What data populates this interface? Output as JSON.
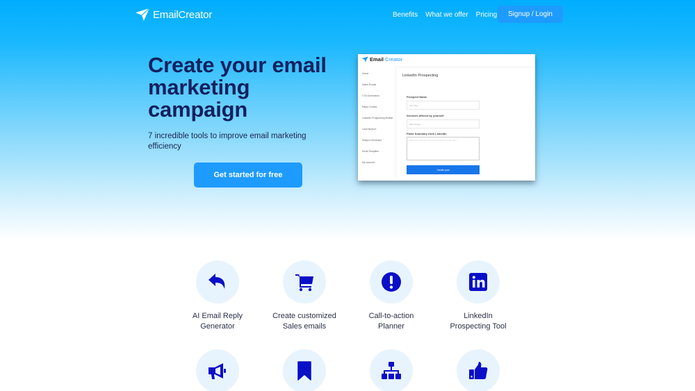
{
  "nav": {
    "brand": "EmailCreator",
    "links": [
      "Benefits",
      "What we offer",
      "Pricing"
    ],
    "signup_label": "Signup / Login"
  },
  "hero": {
    "title_lines": [
      "Create your email",
      "marketing",
      "campaign"
    ],
    "subtitle": "7 incredible tools to improve email marketing efficiency",
    "cta_label": "Get started for free"
  },
  "mockup": {
    "brand_a": "Email",
    "brand_b": "Creator",
    "sidebar": [
      "Home",
      "Sales Emails",
      "CTA Generation",
      "Reply Creator",
      "LinkedIn Prospecting Builder",
      "Lead Nurture",
      "Subject Generator",
      "Email Simplifier",
      "My Account"
    ],
    "page_title": "LinkedIn Prospecting",
    "fields": [
      {
        "label": "Prospect Name",
        "placeholder": "John Doe"
      },
      {
        "label": "Services offered by yourself",
        "placeholder": "Web Design"
      }
    ],
    "textarea_label": "Paste Summary from LinkedIn",
    "textarea_placeholder": "Paste the summary from the prospect's profile here",
    "button_label": "Create post"
  },
  "features": [
    {
      "icon": "reply-icon",
      "line1": "AI Email Reply",
      "line2": "Generator"
    },
    {
      "icon": "cart-icon",
      "line1": "Create customized",
      "line2": "Sales emails"
    },
    {
      "icon": "exclamation-icon",
      "line1": "Call-to-action",
      "line2": "Planner"
    },
    {
      "icon": "linkedin-icon",
      "line1": "LinkedIn",
      "line2": "Prospecting Tool"
    },
    {
      "icon": "megaphone-icon",
      "line1": "",
      "line2": ""
    },
    {
      "icon": "bookmark-icon",
      "line1": "",
      "line2": ""
    },
    {
      "icon": "sitemap-icon",
      "line1": "",
      "line2": ""
    },
    {
      "icon": "thumbs-up-icon",
      "line1": "",
      "line2": ""
    }
  ],
  "colors": {
    "brand_blue": "#1e9bff",
    "navy": "#13205f",
    "icon_blue": "#0a0fc8",
    "icon_bg": "#e8f4fd"
  }
}
